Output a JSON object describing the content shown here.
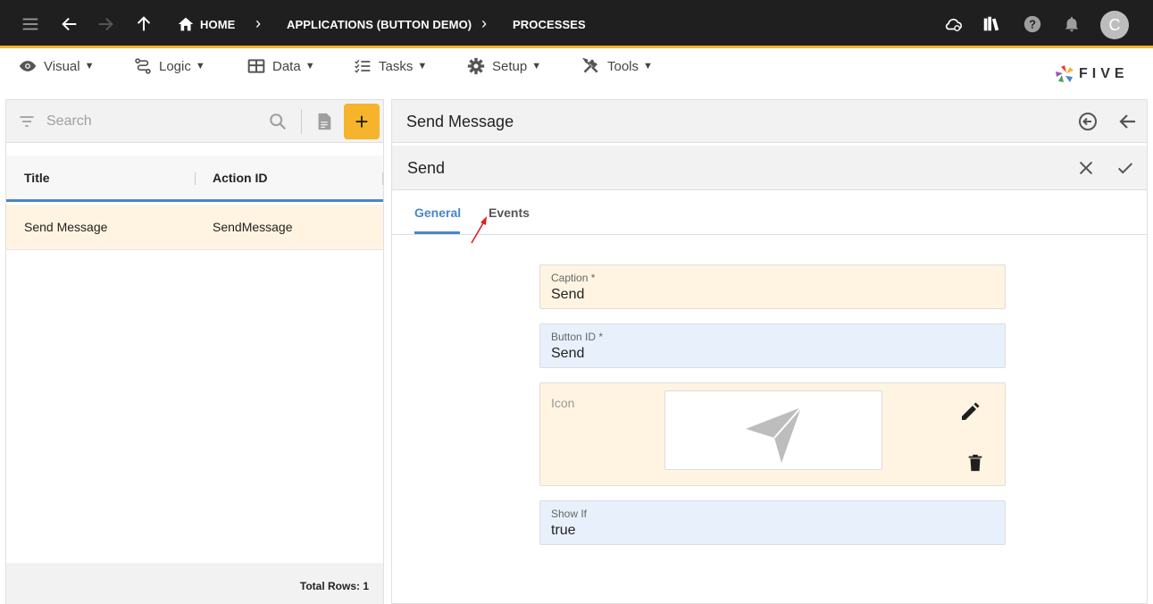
{
  "topbar": {
    "crumbs": [
      "HOME",
      "APPLICATIONS (BUTTON DEMO)",
      "PROCESSES"
    ],
    "avatar_letter": "C"
  },
  "menu": {
    "items": [
      "Visual",
      "Logic",
      "Data",
      "Tasks",
      "Setup",
      "Tools"
    ],
    "logo_text": "FIVE"
  },
  "list": {
    "search_placeholder": "Search",
    "add_label": "+",
    "columns": [
      "Title",
      "Action ID"
    ],
    "rows": [
      {
        "title": "Send Message",
        "action_id": "SendMessage"
      }
    ],
    "total_rows": "Total Rows: 1"
  },
  "detail": {
    "record_title": "Send Message",
    "form_title": "Send",
    "tabs": [
      "General",
      "Events"
    ],
    "fields": {
      "caption_label": "Caption *",
      "caption_value": "Send",
      "button_id_label": "Button ID *",
      "button_id_value": "Send",
      "icon_label": "Icon",
      "show_if_label": "Show If",
      "show_if_value": "true"
    }
  },
  "colors": {
    "topbar": "#1f1f1f",
    "accent": "#f6b42c",
    "tab_active": "#4a86c8",
    "field_yellow": "#fff4e1",
    "field_blue": "#e8f1fb"
  }
}
